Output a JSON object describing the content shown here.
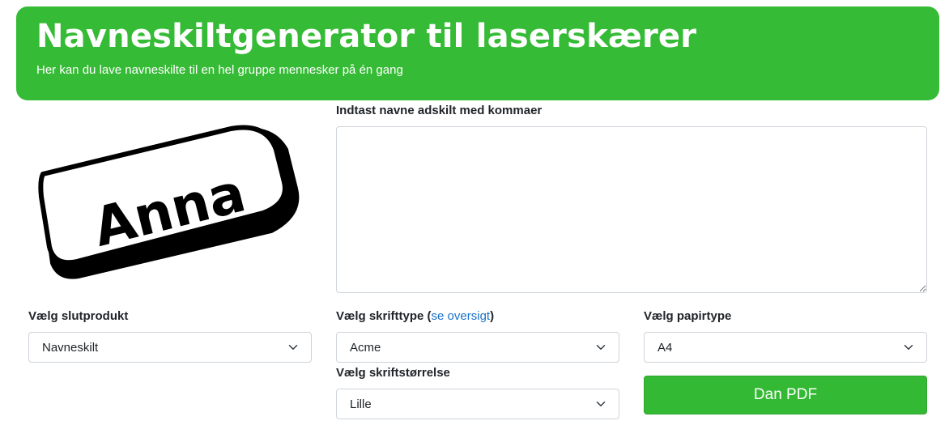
{
  "header": {
    "title": "Navneskiltgenerator til laserskærer",
    "subtitle": "Her kan du lave navneskilte til en hel gruppe mennesker på én gang"
  },
  "preview": {
    "sample_name": "Anna"
  },
  "names": {
    "label": "Indtast navne adskilt med kommaer",
    "value": ""
  },
  "product": {
    "label": "Vælg slutprodukt",
    "selected": "Navneskilt"
  },
  "font": {
    "label": "Vælg skrifttype",
    "link_text": "se oversigt",
    "selected": "Acme"
  },
  "font_size": {
    "label": "Vælg skriftstørrelse",
    "selected": "Lille"
  },
  "paper": {
    "label": "Vælg papirtype",
    "selected": "A4"
  },
  "actions": {
    "generate_label": "Dan PDF"
  },
  "colors": {
    "banner": "#36bb36",
    "button": "#34b934",
    "link": "#1a73c9"
  }
}
